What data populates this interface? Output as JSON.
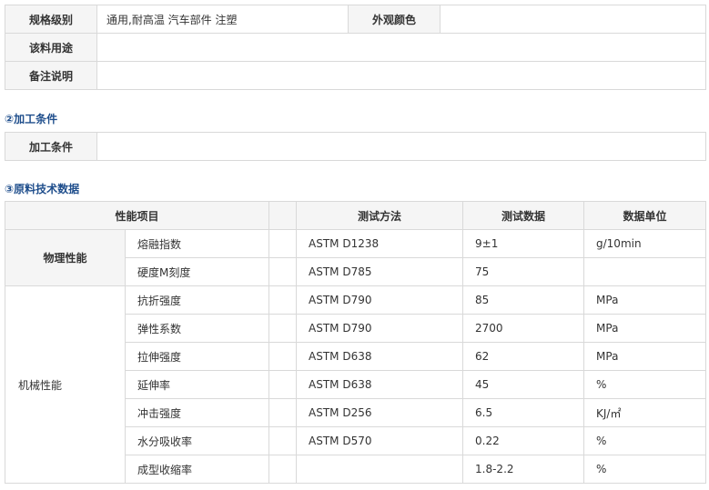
{
  "spec": {
    "grade_label": "规格级别",
    "grade_value": "通用,耐高温 汽车部件 注塑",
    "color_label": "外观颜色",
    "color_value": "",
    "usage_label": "该料用途",
    "usage_value": "",
    "remark_label": "备注说明",
    "remark_value": ""
  },
  "processing": {
    "heading": "②加工条件",
    "label": "加工条件",
    "value": ""
  },
  "tech": {
    "heading": "③原料技术数据",
    "headers": {
      "item": "性能项目",
      "method": "测试方法",
      "data": "测试数据",
      "unit": "数据单位"
    },
    "physical": {
      "group": "物理性能",
      "rows": [
        {
          "name": "熔融指数",
          "method": "ASTM D1238",
          "data": "9±1",
          "unit": "g/10min"
        },
        {
          "name": "硬度M刻度",
          "method": "ASTM D785",
          "data": "75",
          "unit": ""
        }
      ]
    },
    "mechanical": {
      "group": "机械性能",
      "rows": [
        {
          "name": "抗折强度",
          "method": "ASTM D790",
          "data": "85",
          "unit": "MPa"
        },
        {
          "name": "弹性系数",
          "method": "ASTM D790",
          "data": "2700",
          "unit": "MPa"
        },
        {
          "name": "拉伸强度",
          "method": "ASTM D638",
          "data": "62",
          "unit": "MPa"
        },
        {
          "name": "延伸率",
          "method": "ASTM D638",
          "data": "45",
          "unit": "%"
        },
        {
          "name": "冲击强度",
          "method": "ASTM D256",
          "data": "6.5",
          "unit": "KJ/㎡"
        },
        {
          "name": "水分吸收率",
          "method": "ASTM D570",
          "data": "0.22",
          "unit": "%"
        },
        {
          "name": "成型收缩率",
          "method": "",
          "data": "1.8-2.2",
          "unit": "%"
        }
      ]
    }
  }
}
